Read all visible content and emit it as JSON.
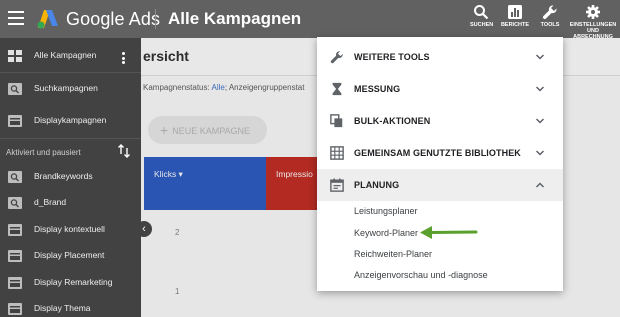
{
  "header": {
    "brand": "Google Ads",
    "page_title": "Alle Kampagnen",
    "nav": [
      {
        "label": "SUCHEN",
        "icon": "search-icon"
      },
      {
        "label": "BERICHTE",
        "icon": "reports-icon"
      },
      {
        "label": "TOOLS",
        "icon": "wrench-icon"
      },
      {
        "label_line1": "EINSTELLUNGEN",
        "label_line2": "UND",
        "label_line3": "ABRECHNUNG",
        "icon": "gear-icon"
      }
    ]
  },
  "sidebar": {
    "top_items": [
      {
        "label": "Alle Kampagnen",
        "icon": "campaigns-icon"
      },
      {
        "label": "Suchkampagnen",
        "icon": "search-campaign-icon"
      },
      {
        "label": "Displaykampagnen",
        "icon": "display-campaign-icon"
      }
    ],
    "section_label": "Aktiviert und pausiert",
    "campaigns": [
      {
        "label": "Brandkeywords",
        "icon": "search-campaign-icon"
      },
      {
        "label": "d_Brand",
        "icon": "search-campaign-icon"
      },
      {
        "label": "Display kontextuell",
        "icon": "display-campaign-icon"
      },
      {
        "label": "Display Placement",
        "icon": "display-campaign-icon"
      },
      {
        "label": "Display Remarketing",
        "icon": "display-campaign-icon"
      },
      {
        "label": "Display Thema",
        "icon": "display-campaign-icon"
      }
    ]
  },
  "main": {
    "overview_title": "ersicht",
    "filter_prefix": "Kampagnenstatus: ",
    "filter_value": "Alle",
    "filter_suffix": "; Anzeigengruppenstat",
    "new_campaign_label": "NEUE KAMPAGNE",
    "metrics": [
      {
        "label": "Klicks ▾"
      },
      {
        "label": "Impressio"
      }
    ],
    "axis_ticks": [
      "2",
      "1"
    ]
  },
  "tools_menu": {
    "sections": [
      {
        "label": "WEITERE TOOLS",
        "icon": "wrench-icon",
        "expanded": false
      },
      {
        "label": "MESSUNG",
        "icon": "hourglass-icon",
        "expanded": false
      },
      {
        "label": "BULK-AKTIONEN",
        "icon": "copy-icon",
        "expanded": false
      },
      {
        "label": "GEMEINSAM GENUTZTE BIBLIOTHEK",
        "icon": "library-icon",
        "expanded": false
      },
      {
        "label": "PLANUNG",
        "icon": "calendar-icon",
        "expanded": true
      }
    ],
    "planning_items": [
      "Leistungsplaner",
      "Keyword-Planer",
      "Reichweiten-Planer",
      "Anzeigenvorschau und -diagnose"
    ]
  },
  "colors": {
    "topbar": "#616161",
    "sidebar": "#424242",
    "clicks_metric": "#2a55b2",
    "impressions_metric": "#b32a22",
    "annotation_arrow": "#5aa02c"
  }
}
